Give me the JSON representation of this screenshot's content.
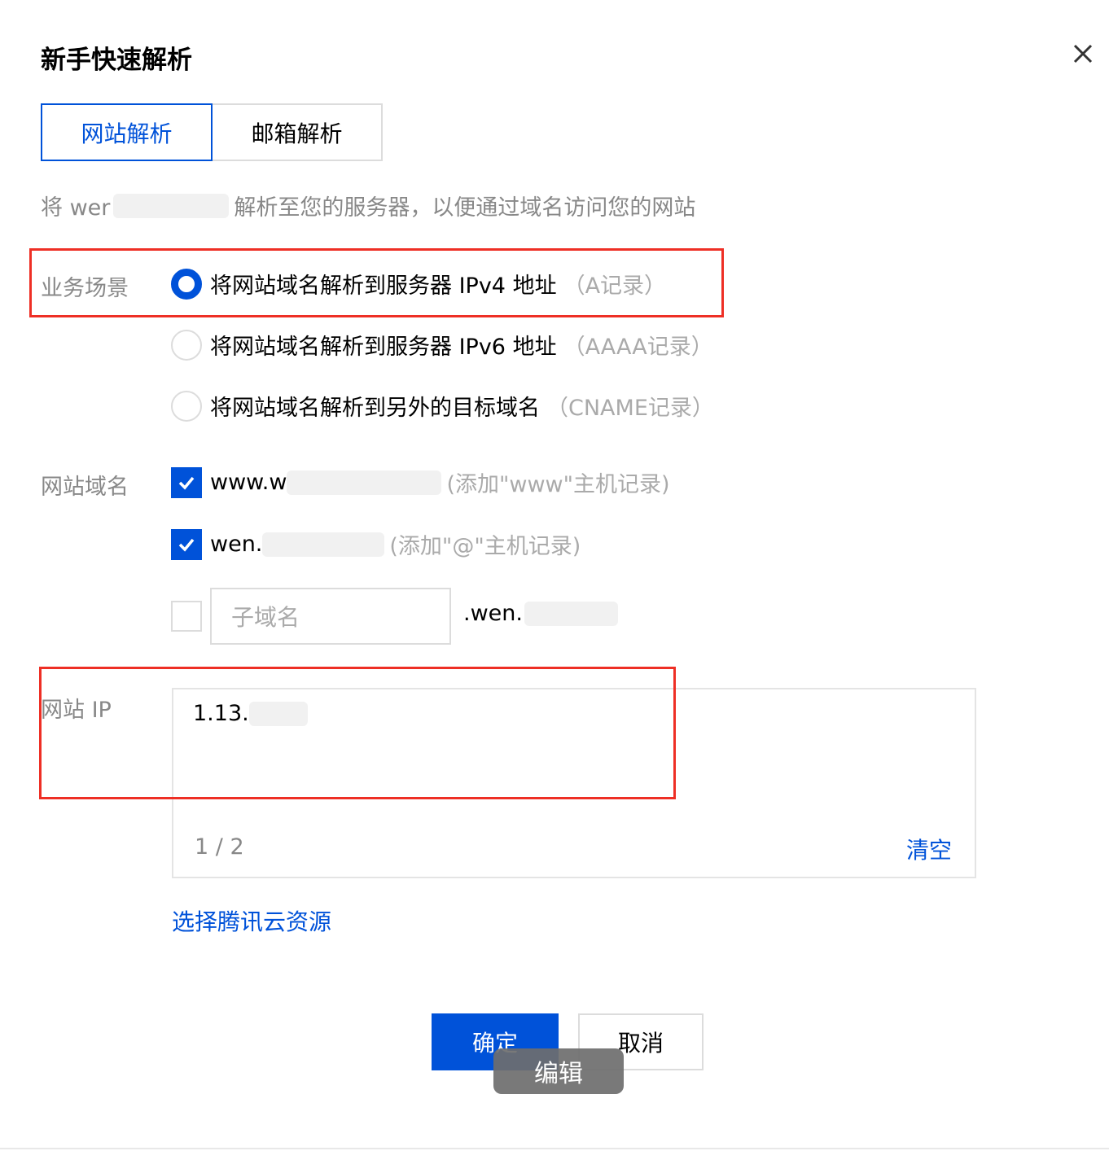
{
  "dialog": {
    "title": "新手快速解析"
  },
  "tabs": [
    {
      "label": "网站解析",
      "active": true
    },
    {
      "label": "邮箱解析",
      "active": false
    }
  ],
  "description": {
    "prefix": "将 wer",
    "suffix": "解析至您的服务器，以便通过域名访问您的网站"
  },
  "scenario": {
    "label": "业务场景",
    "options": [
      {
        "text": "将网站域名解析到服务器 IPv4 地址",
        "note": "（A记录）",
        "selected": true
      },
      {
        "text": "将网站域名解析到服务器 IPv6 地址",
        "note": "（AAAA记录）",
        "selected": false
      },
      {
        "text": "将网站域名解析到另外的目标域名",
        "note": "（CNAME记录）",
        "selected": false
      }
    ]
  },
  "domains": {
    "label": "网站域名",
    "items": [
      {
        "text": "www.w",
        "note": "(添加\"www\"主机记录)",
        "checked": true
      },
      {
        "text": "wen.",
        "note": "(添加\"@\"主机记录)",
        "checked": true
      }
    ],
    "subdomain": {
      "placeholder": "子域名",
      "checked": false,
      "suffix": ".wen."
    }
  },
  "ip": {
    "label": "网站 IP",
    "value": "1.13.",
    "count": "1 / 2",
    "clear_label": "清空"
  },
  "resource_link": "选择腾讯云资源",
  "buttons": {
    "ok": "确定",
    "cancel": "取消"
  },
  "overlay": {
    "edit_label": "编辑"
  },
  "colors": {
    "accent": "#0052d9",
    "highlight": "#ee2f25"
  }
}
